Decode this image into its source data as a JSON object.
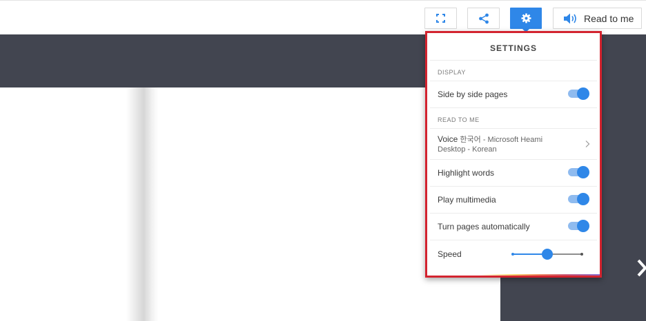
{
  "toolbar": {
    "fullscreen_icon": "fullscreen-icon",
    "share_icon": "share-icon",
    "settings_icon": "gear-icon",
    "read_icon": "speaker-icon",
    "read_label": "Read to me"
  },
  "settings": {
    "title": "SETTINGS",
    "display_section": "DISPLAY",
    "side_by_side": {
      "label": "Side by side pages",
      "on": true
    },
    "read_section": "READ TO ME",
    "voice": {
      "label": "Voice",
      "value": "한국어 - Microsoft Heami Desktop - Korean"
    },
    "highlight_words": {
      "label": "Highlight words",
      "on": true
    },
    "play_multimedia": {
      "label": "Play multimedia",
      "on": true
    },
    "turn_pages": {
      "label": "Turn pages automatically",
      "on": true
    },
    "speed": {
      "label": "Speed",
      "value": 0.5
    }
  },
  "colors": {
    "accent": "#2f87e8",
    "highlight_border": "#d3232f",
    "dark_background": "#424550"
  },
  "nav": {
    "next_icon": "chevron-right-icon"
  }
}
